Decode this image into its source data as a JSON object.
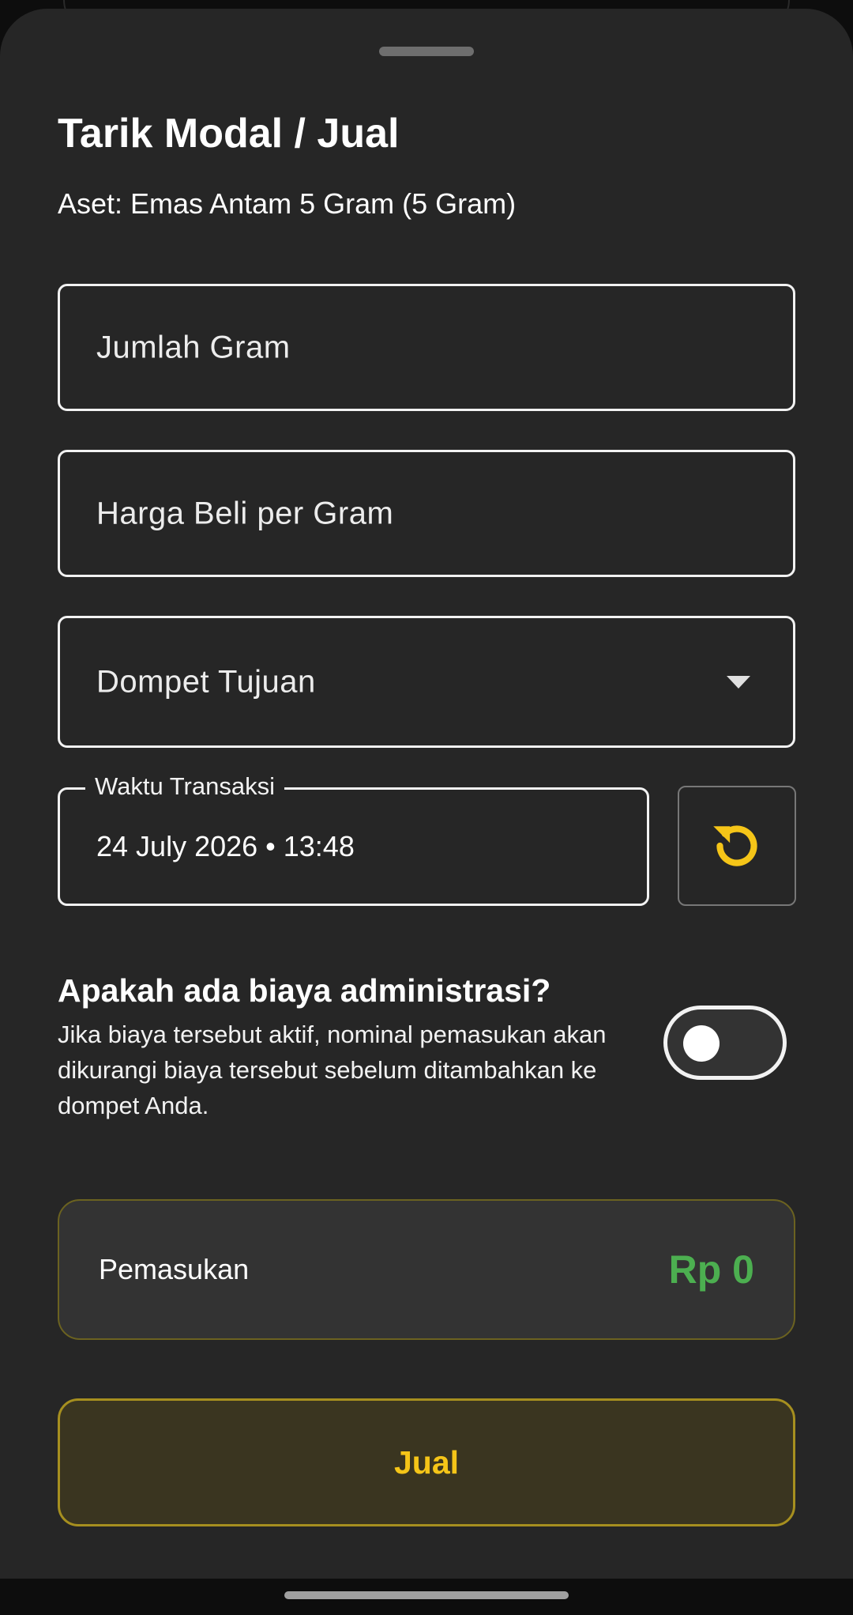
{
  "sheet": {
    "title": "Tarik Modal / Jual",
    "asset_line": "Aset: Emas Antam 5 Gram (5 Gram)"
  },
  "form": {
    "amount_placeholder": "Jumlah Gram",
    "price_placeholder": "Harga Beli per Gram",
    "wallet_placeholder": "Dompet Tujuan",
    "time_label": "Waktu Transaksi",
    "time_value": "24 July 2026 • 13:48"
  },
  "admin_fee": {
    "title": "Apakah ada biaya administrasi?",
    "description": "Jika biaya tersebut aktif, nominal pemasukan akan dikurangi biaya tersebut sebelum ditambahkan ke dompet Anda.",
    "enabled": false
  },
  "income": {
    "label": "Pemasukan",
    "value": "Rp 0"
  },
  "actions": {
    "sell_label": "Jual"
  },
  "icons": {
    "reset": "reset-time-icon",
    "dropdown": "chevron-down-icon"
  },
  "colors": {
    "sheet_background": "#262626",
    "accent_yellow": "#f5c518",
    "income_green": "#4caf50"
  }
}
